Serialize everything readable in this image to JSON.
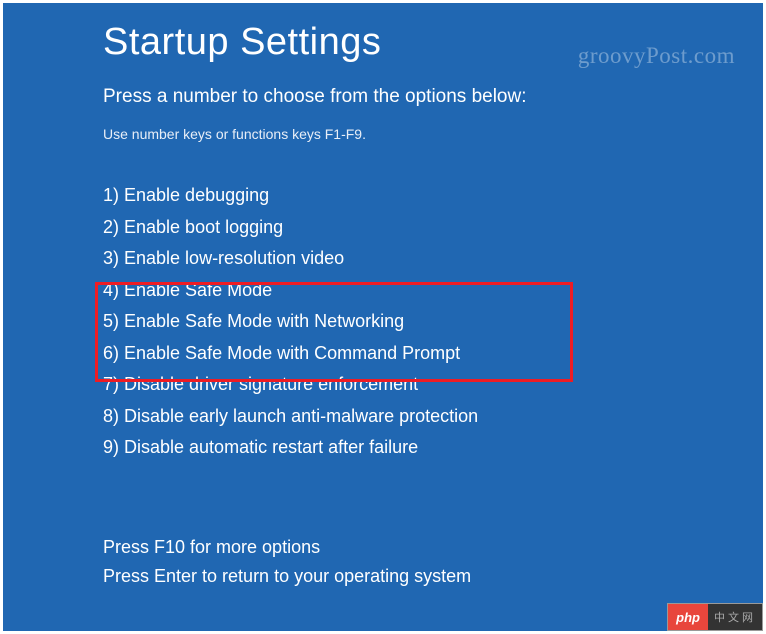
{
  "title": "Startup Settings",
  "subtitle": "Press a number to choose from the options below:",
  "hint": "Use number keys or functions keys F1-F9.",
  "options": [
    "1) Enable debugging",
    "2) Enable boot logging",
    "3) Enable low-resolution video",
    "4) Enable Safe Mode",
    "5) Enable Safe Mode with Networking",
    "6) Enable Safe Mode with Command Prompt",
    "7) Disable driver signature enforcement",
    "8) Disable early launch anti-malware protection",
    "9) Disable automatic restart after failure"
  ],
  "footer": {
    "line1": "Press F10 for more options",
    "line2": "Press Enter to return to your operating system"
  },
  "watermark": "groovyPost.com",
  "badge": {
    "left": "php",
    "right": "中文网"
  }
}
